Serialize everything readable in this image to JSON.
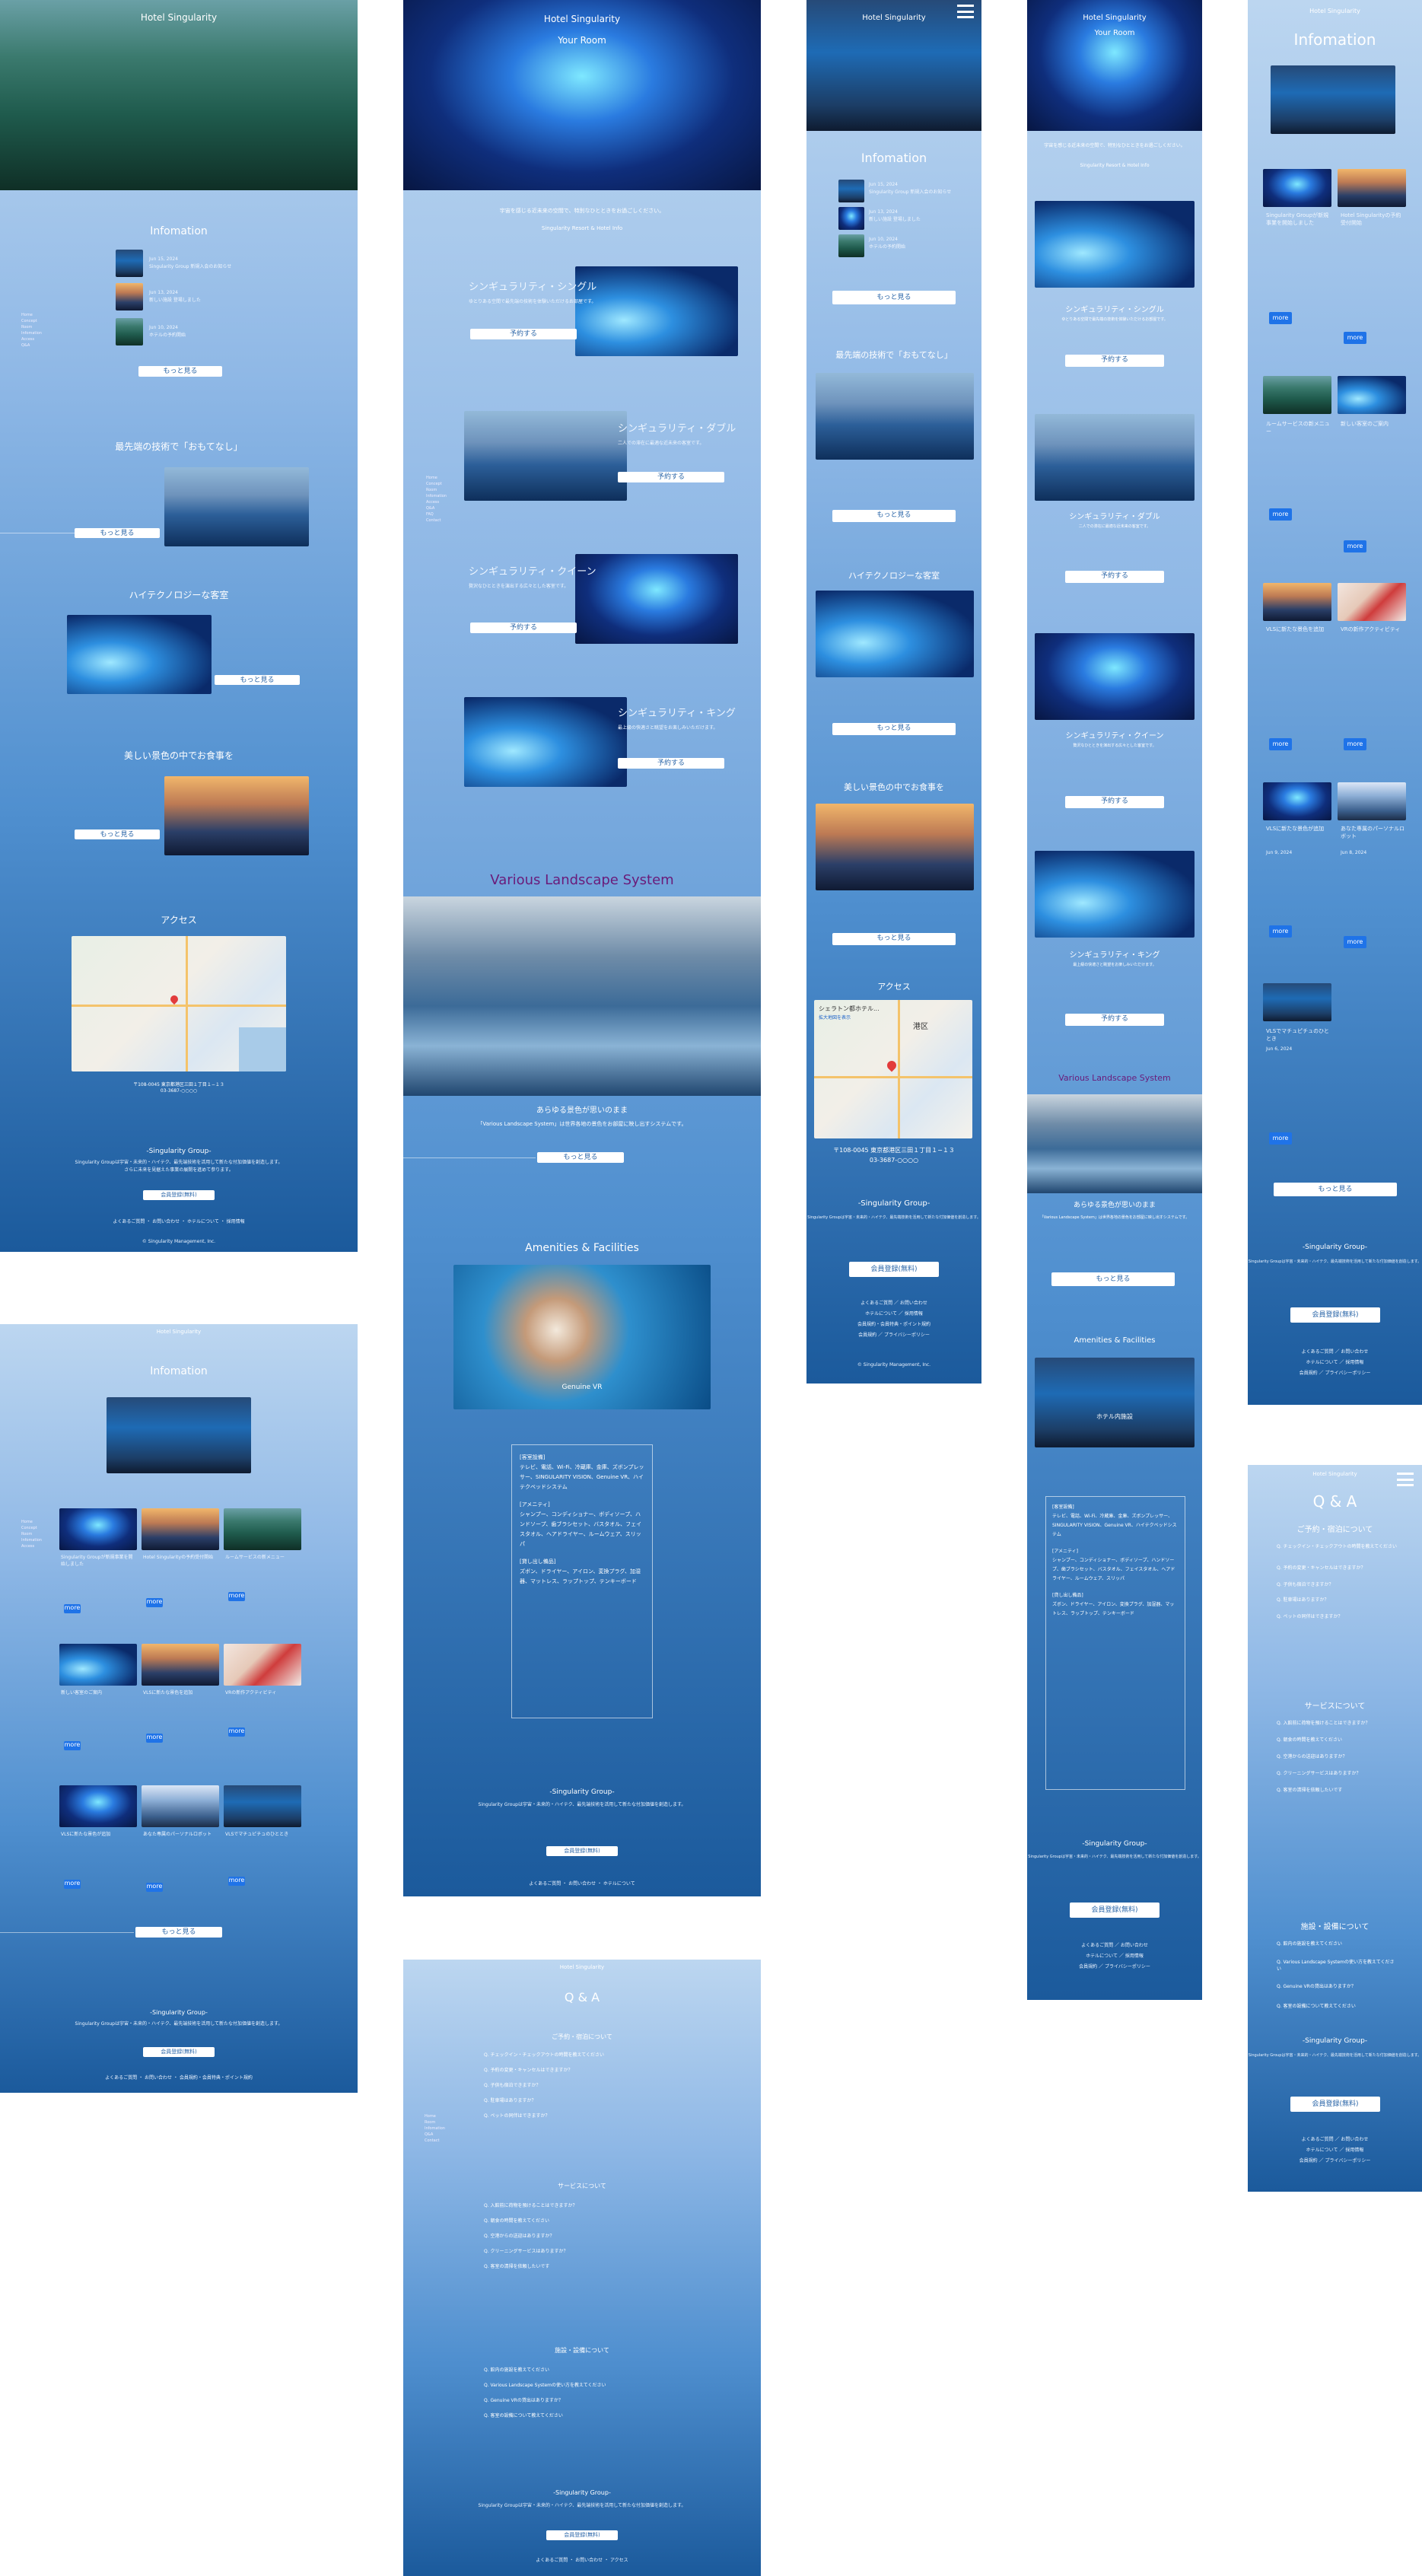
{
  "hotel_name": "Hotel Singularity",
  "your_room": "Your Room",
  "info_title": "Infomation",
  "info_title_big": "Infomation",
  "news": [
    {
      "date": "Jun 15, 2024",
      "text": "Singularity Group 新規入会のお知らせ"
    },
    {
      "date": "Jun 13, 2024",
      "text": "新しい施設 登場しました"
    },
    {
      "date": "Jun 10, 2024",
      "text": "ホテルの予約開始"
    }
  ],
  "more_btn": "もっと見る",
  "reserve_btn": "予約する",
  "feature_tec": "最先端の技術で「おもてなし」",
  "feature_hitech": "ハイテクノロジーな客室",
  "feature_dinner": "美しい景色の中でお食事を",
  "access_title": "アクセス",
  "address": "〒108-0045 東京都港区三田１丁目１−１３",
  "address2": "03-3687-○○○○",
  "map_label": "シェラトン都ホテル...",
  "map_link": "拡大地図を表示",
  "map_ward": "港区",
  "group_title": "-Singularity Group-",
  "group_desc": "Singularity Groupは宇宙・未来的・ハイテク、最先端技術を活用して新たな付加価値を創造します。",
  "group_desc2": "さらに未来を見据えた事業の展開を進めて参ります。",
  "member_btn": "会員登録(無料)",
  "footer_links": [
    "よくあるご質問",
    "お問い合わせ",
    "ホテルについて",
    "採用情報",
    "会員規約・会員特典・ポイント規約",
    "アクセス",
    "会員規約",
    "プライバシーポリシー"
  ],
  "copyright": "© Singularity Management, Inc.",
  "rooms": [
    {
      "name": "シンギュラリティ・シングル",
      "desc": "ゆとりある空間で最先端の技術を体験いただけるお部屋です。"
    },
    {
      "name": "シンギュラリティ・ダブル",
      "desc": "二人での滞在に最適な近未来の客室です。"
    },
    {
      "name": "シンギュラリティ・クイーン",
      "desc": "贅沢なひとときを演出する広々とした客室です。"
    },
    {
      "name": "シンギュラリティ・キング",
      "desc": "最上級の快適さと眺望をお楽しみいただけます。"
    }
  ],
  "room_intro": "宇宙を感じる近未来の空間で、特別なひとときをお過ごしください。",
  "room_intro_link": "Singularity Resort & Hotel Info",
  "landscape_title": "Various Landscape System",
  "landscape_sub": "あらゆる景色が思いのまま",
  "landscape_desc": "「Various Landscape System」は世界各地の景色をお部屋に映し出すシステムです。",
  "amenities_title": "Amenities & Facilities",
  "amenity_caption": "Genuine VR",
  "amenity_caption2": "ホテル内施設",
  "amenity_box": [
    "[客室設備]",
    "テレビ、電話、Wi-Fi、冷蔵庫、金庫、ズボンプレッサー、SINGULARITY VISION、Genuine VR、ハイテクベッドシステム",
    "[アメニティ]",
    "シャンプー、コンディショナー、ボディソープ、ハンドソープ、歯ブラシセット、バスタオル、フェイスタオル、ヘアドライヤー、ルームウェア、スリッパ",
    "[貸し出し備品]",
    "ズボン、ドライヤー、アイロン、変換プラグ、加湿器、マットレス、ラップトップ、テンキーボード"
  ],
  "qa_title": "Q & A",
  "qa_reserve": "ご予約・宿泊について",
  "qa_service": "サービスについて",
  "qa_facility": "施設・設備について",
  "qa_reserve_items": [
    "Q. チェックイン・チェックアウトの時間を教えてください",
    "Q. 予約の変更・キャンセルはできますか？",
    "Q. 子供も宿泊できますか？",
    "Q. 駐車場はありますか？",
    "Q. ペットの同伴はできますか？"
  ],
  "qa_service_items": [
    "Q. 入館前に荷物を預けることはできますか？",
    "Q. 朝食の時間を教えてください",
    "Q. 空港からの送迎はありますか？",
    "Q. クリーニングサービスはありますか？",
    "Q. 客室の清掃を依頼したいです"
  ],
  "qa_facility_items": [
    "Q. 館内の施設を教えてください",
    "Q. Various Landscape Systemの使い方を教えてください",
    "Q. Genuine VRの貸出はありますか？",
    "Q. 客室の設備について教えてください"
  ],
  "news_cards": [
    {
      "title": "Singularity Groupが新規事業を開始しました",
      "date": "Jun 15, 2024"
    },
    {
      "title": "Hotel Singularityの予約受付開始",
      "date": "Jun 14, 2024"
    },
    {
      "title": "ルームサービスの新メニュー",
      "date": "Jun 13, 2024"
    },
    {
      "title": "新しい客室のご案内",
      "date": "Jun 12, 2024"
    },
    {
      "title": "VLSに新たな景色を追加",
      "date": "Jun 11, 2024"
    },
    {
      "title": "VRの新作アクティビティ",
      "date": "Jun 10, 2024"
    },
    {
      "title": "VLSに新たな景色が追加",
      "date": "Jun 9, 2024"
    },
    {
      "title": "あなた専属のパーソナルロボット",
      "date": "Jun 8, 2024"
    },
    {
      "title": "VLSでマチュピチュのひととき",
      "date": "Jun 6, 2024"
    }
  ],
  "more_small": "more",
  "side_menu": [
    "Home",
    "Concept",
    "Room",
    "Infomation",
    "Access",
    "Q&A",
    "FAQ",
    "Contact",
    "Login"
  ],
  "colors": {
    "accent": "#1f73e8",
    "purple_title": "#6a1b7a",
    "bg_top": "#bcd6f0",
    "bg_bottom": "#1b5a9c"
  }
}
